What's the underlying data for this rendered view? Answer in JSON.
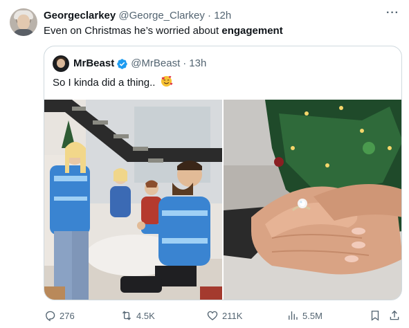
{
  "author": {
    "display_name": "Georgeclarkey",
    "handle": "@George_Clarkey",
    "separator": "·",
    "time": "12h"
  },
  "tweet": {
    "text_prefix": "Even on Christmas he’s worried about ",
    "text_bold": "engagement"
  },
  "more_glyph": "···",
  "quoted": {
    "display_name": "MrBeast",
    "handle": "@MrBeast",
    "separator": "·",
    "time": "13h",
    "text": "So I kinda did a thing..",
    "verified": true
  },
  "media": [
    {
      "icon": "photo-proposal-scene"
    },
    {
      "icon": "photo-ring-hand"
    }
  ],
  "actions": {
    "replies": "276",
    "retweets": "4.5K",
    "likes": "211K",
    "views": "5.5M"
  },
  "colors": {
    "text": "#0f1419",
    "muted": "#536471",
    "border": "#cfd9de",
    "verified": "#1d9bf0"
  }
}
